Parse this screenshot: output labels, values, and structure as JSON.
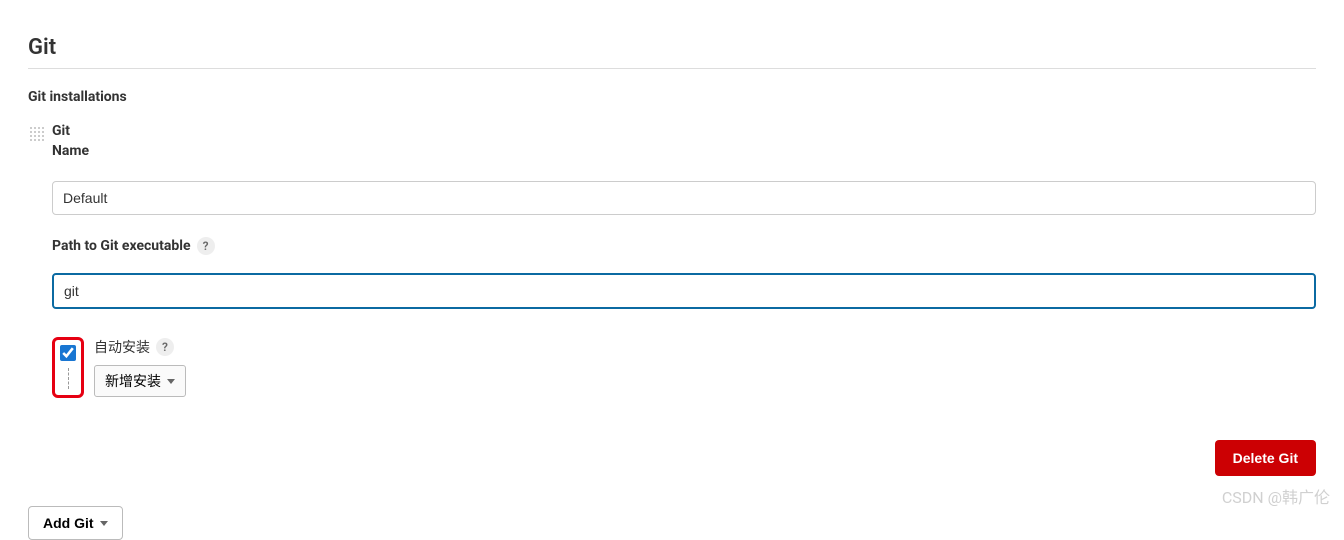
{
  "section": {
    "title": "Git",
    "installations_label": "Git installations"
  },
  "git_group": {
    "heading": "Git",
    "name_label": "Name",
    "name_value": "Default",
    "path_label": "Path to Git executable",
    "path_value": "git",
    "auto_install_label": "自动安装",
    "add_installer_label": "新增安装",
    "delete_label": "Delete Git"
  },
  "footer": {
    "add_git_label": "Add Git"
  },
  "watermark": "CSDN @韩广伦"
}
